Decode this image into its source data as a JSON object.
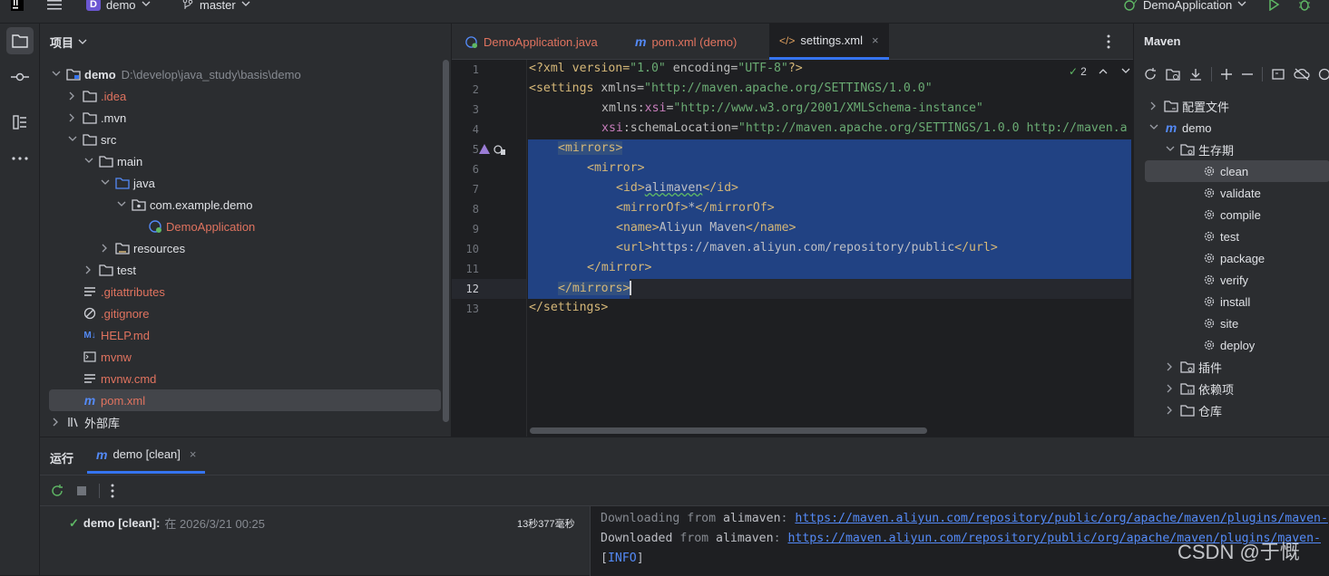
{
  "titlebar": {
    "project_badge": "D",
    "project_name": "demo",
    "branch": "master",
    "run_config": "DemoApplication"
  },
  "project_panel": {
    "title": "项目",
    "root": {
      "name": "demo",
      "path": "D:\\develop\\java_study\\basis\\demo"
    },
    "items": [
      ".idea",
      ".mvn",
      "src",
      "main",
      "java",
      "com.example.demo",
      "DemoApplication",
      "resources",
      "test",
      ".gitattributes",
      ".gitignore",
      "HELP.md",
      "mvnw",
      "mvnw.cmd",
      "pom.xml",
      "外部库"
    ]
  },
  "editor": {
    "tabs": [
      {
        "label": "DemoApplication.java"
      },
      {
        "label": "pom.xml (demo)"
      },
      {
        "label": "settings.xml"
      }
    ],
    "warnings_count": "2",
    "line_numbers": [
      "1",
      "2",
      "3",
      "4",
      "5",
      "6",
      "7",
      "8",
      "9",
      "10",
      "11",
      "12",
      "13"
    ],
    "lines": {
      "l1": [
        "<?xml version=",
        "\"1.0\"",
        " encoding=",
        "\"UTF-8\"",
        "?>"
      ],
      "l2": [
        "<settings",
        " xmlns=",
        "\"http://maven.apache.org/SETTINGS/1.0.0\""
      ],
      "l3": [
        "xmlns:",
        "xsi",
        "=",
        "\"http://www.w3.org/2001/XMLSchema-instance\""
      ],
      "l4": [
        "xsi",
        ":schemaLocation=",
        "\"http://maven.apache.org/SETTINGS/1.0.0 http://maven.a"
      ],
      "l5": "<mirrors>",
      "l6": "<mirror>",
      "l7": [
        "<id>",
        "alimaven",
        "</id>"
      ],
      "l8": [
        "<mirrorOf>",
        "*",
        "</mirrorOf>"
      ],
      "l9": [
        "<name>",
        "Aliyun Maven",
        "</name>"
      ],
      "l10": [
        "<url>",
        "https://maven.aliyun.com/repository/public",
        "</url>"
      ],
      "l11": "</mirror>",
      "l12": "</mirrors>",
      "l13": "</settings>"
    }
  },
  "maven_panel": {
    "title": "Maven",
    "items": [
      "配置文件",
      "demo",
      "生存期",
      "clean",
      "validate",
      "compile",
      "test",
      "package",
      "verify",
      "install",
      "site",
      "deploy",
      "插件",
      "依赖项",
      "仓库"
    ]
  },
  "run_panel": {
    "title": "运行",
    "tab_label": "demo [clean]",
    "result_label": "demo [clean]:",
    "result_time": "在 2026/3/21 00:25",
    "duration": "13秒377毫秒",
    "console": [
      {
        "prefix": "Downloading ",
        "from": "from",
        "who": " alimaven",
        ":": ": ",
        "url": "https://maven.aliyun.com/repository/public/org/apache/maven/plugins/maven-"
      },
      {
        "prefix": "Downloaded ",
        "from": "from",
        "who": " alimaven",
        ":": ": ",
        "url": "https://maven.aliyun.com/repository/public/org/apache/maven/plugins/maven-"
      },
      {
        "info": "[INFO]"
      }
    ]
  },
  "watermark": "CSDN @于慨",
  "colors": {
    "accent": "#3574f0",
    "selection": "#214283",
    "tag": "#d5b778",
    "string": "#6aab73",
    "link": "#548af7",
    "file_red": "#e0735f"
  }
}
